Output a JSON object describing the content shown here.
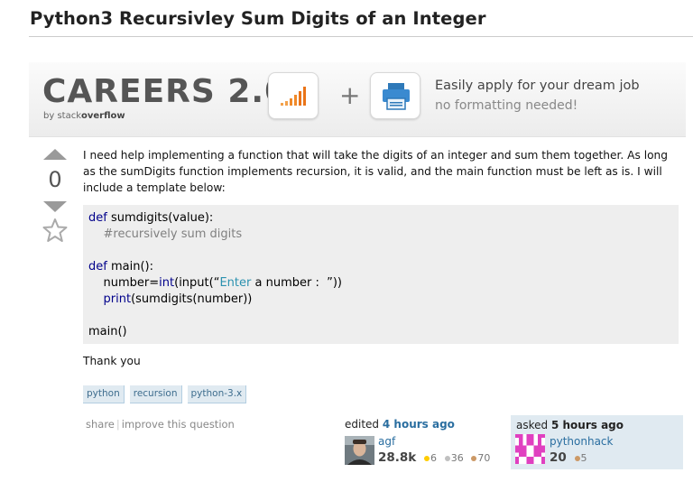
{
  "question": {
    "title": "Python3 Recursivley Sum Digits of an Integer",
    "vote_count": "0",
    "body": "I need help implementing a function that will take the digits of an integer and sum them together. As long as the sumDigits function implements recursion, it is valid, and the main function must be left as is. I will include a template below:",
    "code": {
      "l1_kw": "def",
      "l1_rest": " sumdigits(value):",
      "l2_comment": "#recursively sum digits",
      "l4_kw": "def",
      "l4_rest": " main():",
      "l5_pre": "number=",
      "l5_int": "int",
      "l5_mid": "(input(“",
      "l5_enter": "Enter",
      "l5_post": " a number :  ”))",
      "l6_print": "print",
      "l6_rest": "(sumdigits(number))",
      "l8": "main()"
    },
    "thanks": "Thank you",
    "tags": [
      "python",
      "recursion",
      "python-3.x"
    ]
  },
  "banner": {
    "careers": "CAREERS 2.0",
    "by": "by stack",
    "by_bold": "overflow",
    "plus": "+",
    "line1": "Easily apply for your dream job",
    "line2": "no formatting needed!"
  },
  "post_menu": {
    "share": "share",
    "sep": "|",
    "improve": "improve this question"
  },
  "edited": {
    "label": "edited",
    "time": "4 hours ago",
    "user": "agf",
    "rep": "28.8k",
    "gold": "6",
    "silver": "36",
    "bronze": "70"
  },
  "asked": {
    "label": "asked",
    "time": "5 hours ago",
    "user": "pythonhack",
    "rep": "20",
    "bronze": "5"
  },
  "colors": {
    "link": "#2a6ea0",
    "tag_bg": "#e0eaf1",
    "code_bg": "#eeeeee",
    "gold": "#ffcc00",
    "silver": "#c0c0c0",
    "bronze": "#cc9966"
  }
}
